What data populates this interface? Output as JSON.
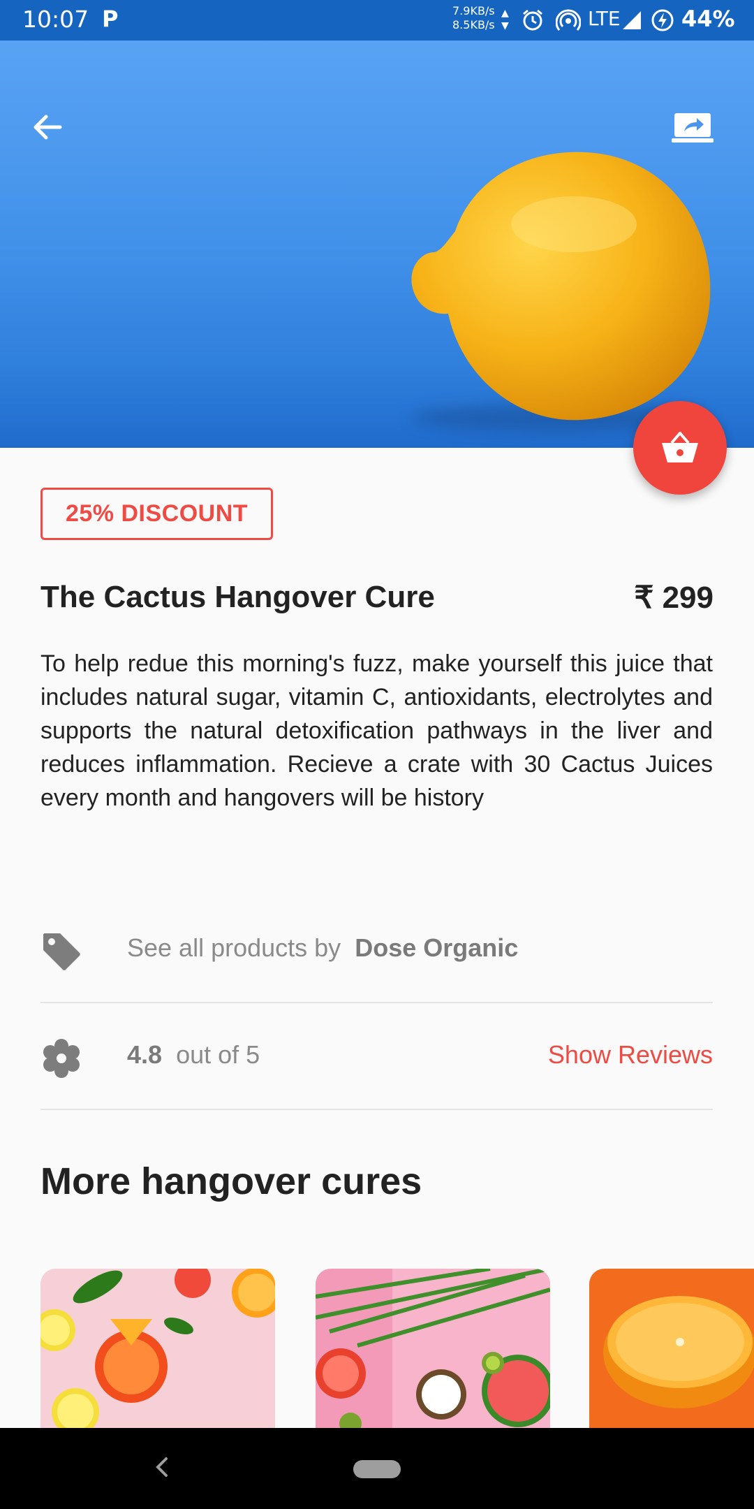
{
  "status_bar": {
    "time": "10:07",
    "parking_glyph": "P",
    "speed_up": "7.9KB/s",
    "speed_down": "8.5KB/s",
    "network": "LTE",
    "battery": "44%",
    "icons": [
      "alarm-icon",
      "hotspot-icon",
      "signal-icon",
      "battery-charging-icon"
    ]
  },
  "hero": {
    "back_icon": "arrow-left-icon",
    "share_icon": "share-screen-icon"
  },
  "fab": {
    "icon": "basket-icon",
    "color": "#f0453c"
  },
  "product": {
    "discount_badge": "25% DISCOUNT",
    "title": "The Cactus Hangover Cure",
    "price": "₹ 299",
    "description": "To help redue this morning's fuzz, make yourself this juice that includes natural sugar, vitamin C, antioxidants, electrolytes and supports the natural detoxification pathways in the liver and reduces inflammation. Recieve a crate with 30 Cactus Juices every month and hangovers will be history"
  },
  "seller_row": {
    "icon": "tag-icon",
    "prefix": "See all products by",
    "brand": "Dose Organic"
  },
  "rating_row": {
    "icon": "flower-icon",
    "rating": "4.8",
    "suffix": "out of 5",
    "link": "Show Reviews"
  },
  "more_section": {
    "title": "More hangover cures"
  },
  "colors": {
    "accent": "#ef4b45",
    "status_bar": "#1565c0"
  }
}
